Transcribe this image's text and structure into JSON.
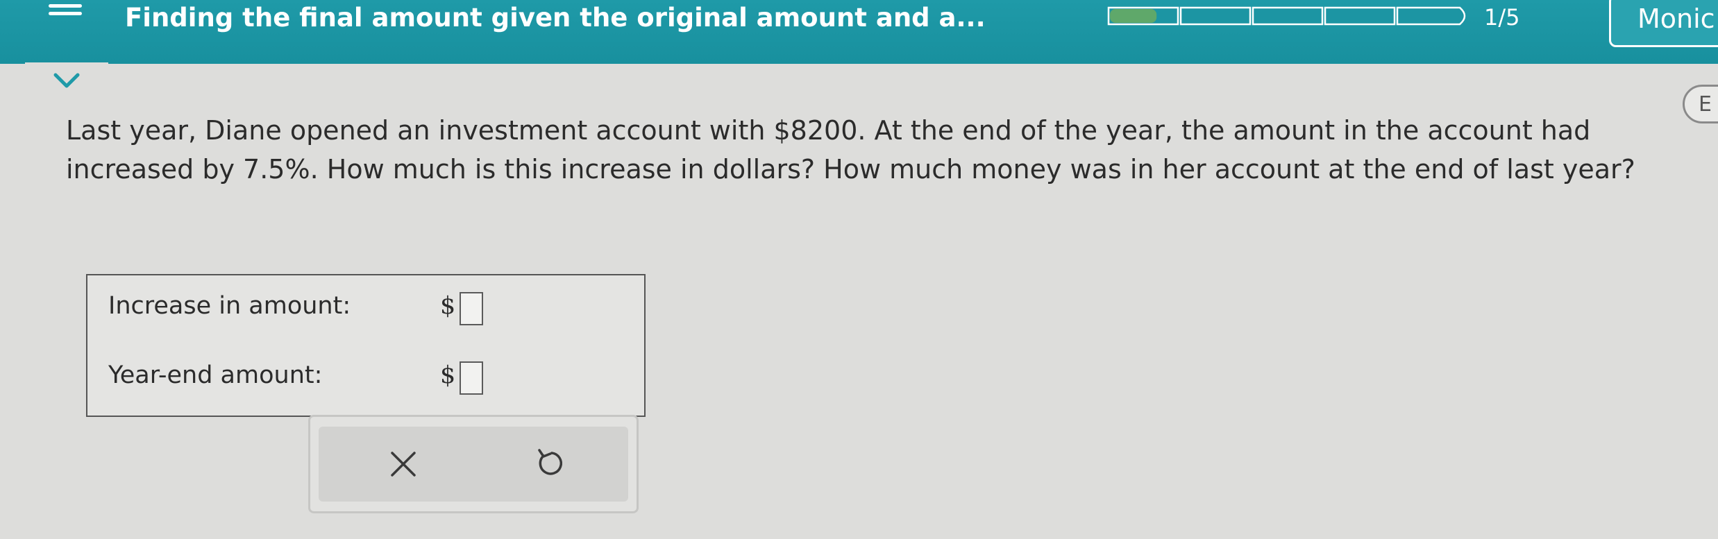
{
  "header": {
    "topic_title": "Finding the final amount given the original amount and a...",
    "progress": {
      "current": 1,
      "total": 5,
      "label": "1/5",
      "first_segment_fill": 0.7
    },
    "user_name": "Monic"
  },
  "explain_button": {
    "label": "E"
  },
  "question": {
    "text": "Last year, Diane opened an investment account with $8200. At the end of the year, the amount in the account had increased by 7.5%. How much is this increase in dollars? How much money was in her account at the end of last year?"
  },
  "answers": [
    {
      "label": "Increase in amount:",
      "currency": "$",
      "value": ""
    },
    {
      "label": "Year-end amount:",
      "currency": "$",
      "value": ""
    }
  ],
  "actions": {
    "clear_icon": "x-icon",
    "undo_icon": "undo-icon"
  },
  "colors": {
    "header_bg": "#1f9aa8",
    "progress_fill": "#5fa86a",
    "page_bg": "#dddddb",
    "text": "#2b2b2b"
  }
}
